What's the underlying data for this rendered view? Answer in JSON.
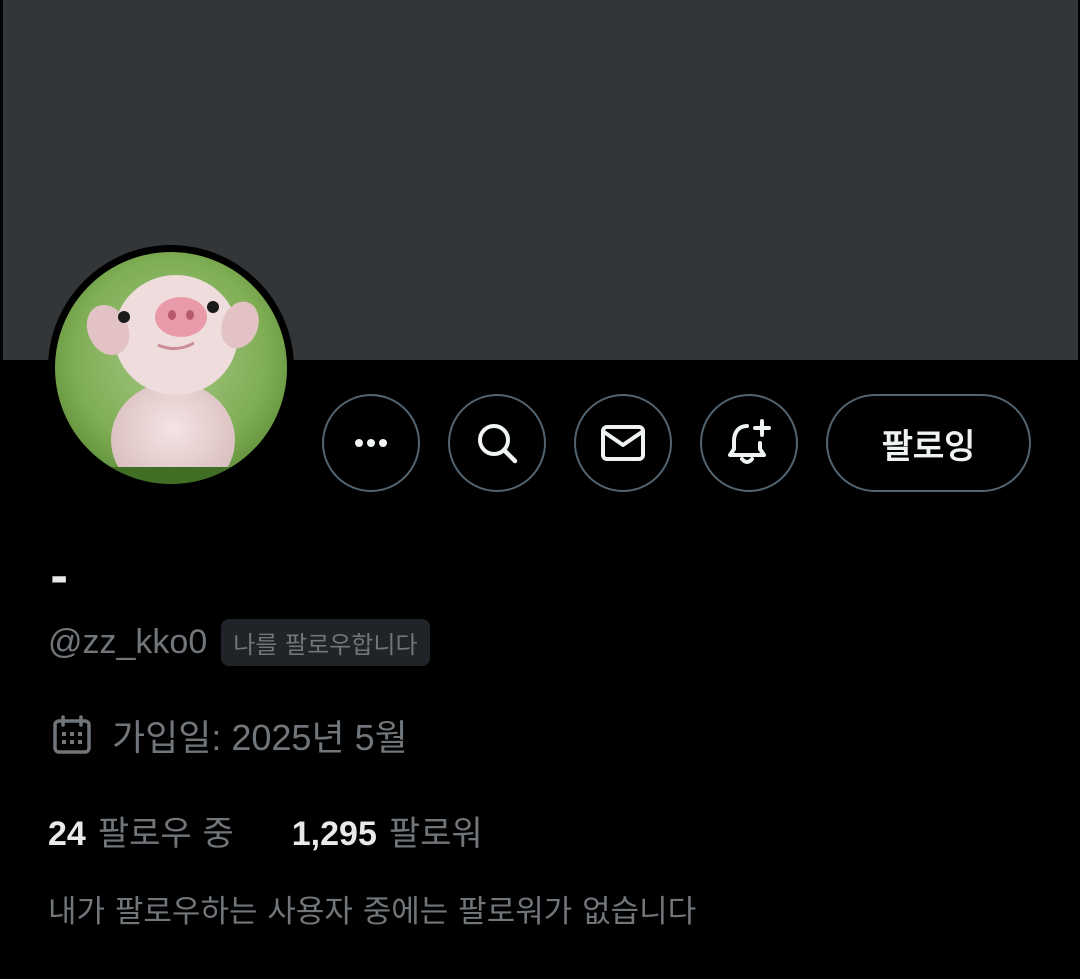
{
  "profile": {
    "display_name": "-",
    "handle": "@zz_kko0",
    "follows_you_badge": "나를 팔로우합니다",
    "joined": "가입일: 2025년 5월",
    "avatar_description": "piglet-photo"
  },
  "actions": {
    "more_icon": "more-horizontal-icon",
    "search_icon": "search-icon",
    "message_icon": "mail-icon",
    "notify_icon": "bell-plus-icon",
    "follow_button_label": "팔로잉"
  },
  "stats": {
    "following_count": "24",
    "following_label": "팔로우 중",
    "followers_count": "1,295",
    "followers_label": "팔로워"
  },
  "mutuals_note": "내가 팔로우하는 사용자 중에는 팔로워가 없습니다",
  "colors": {
    "background": "#000000",
    "banner": "#333639",
    "border": "#536471",
    "text_primary": "#e7e9ea",
    "text_secondary": "#71767b",
    "badge_bg": "#202327"
  }
}
